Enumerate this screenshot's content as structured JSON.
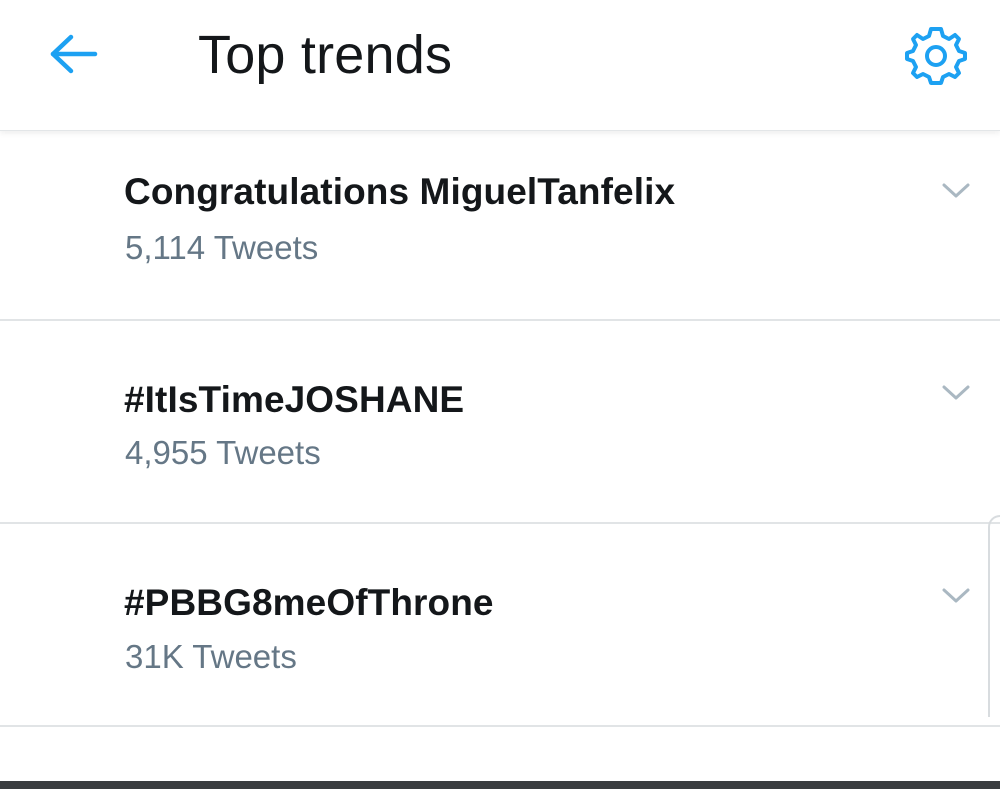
{
  "header": {
    "title": "Top trends",
    "back_icon": "arrow-left-icon",
    "settings_icon": "gear-icon"
  },
  "colors": {
    "accent": "#1da1f2",
    "text_primary": "#14171a",
    "text_secondary": "#657786",
    "divider": "#e1e4e6"
  },
  "trends": [
    {
      "name": "Congratulations MiguelTanfelix",
      "count": "5,114 Tweets"
    },
    {
      "name": "#ItIsTimeJOSHANE",
      "count": "4,955 Tweets"
    },
    {
      "name": "#PBBG8meOfThrone",
      "count": "31K Tweets"
    }
  ]
}
